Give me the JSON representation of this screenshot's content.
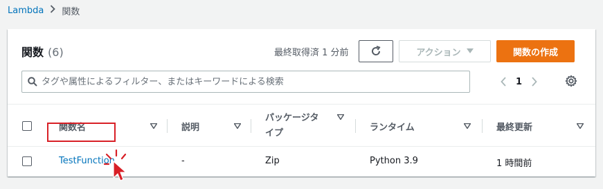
{
  "breadcrumb": {
    "root": "Lambda",
    "current": "関数"
  },
  "header": {
    "title": "関数",
    "count": "(6)",
    "last_fetched": "最終取得済 1 分前",
    "action_label": "アクション",
    "create_label": "関数の作成"
  },
  "search": {
    "placeholder": "タグや属性によるフィルター、またはキーワードによる検索",
    "value": ""
  },
  "pagination": {
    "page": "1"
  },
  "table": {
    "columns": [
      "関数名",
      "説明",
      "パッケージタイプ",
      "ランタイム",
      "最終更新"
    ],
    "rows": [
      {
        "name": "TestFunction",
        "description": "-",
        "package_type": "Zip",
        "runtime": "Python 3.9",
        "last_modified": "1 時間前"
      }
    ]
  },
  "colors": {
    "accent": "#ec7211",
    "link": "#0073bb",
    "highlight": "#d81f26"
  }
}
